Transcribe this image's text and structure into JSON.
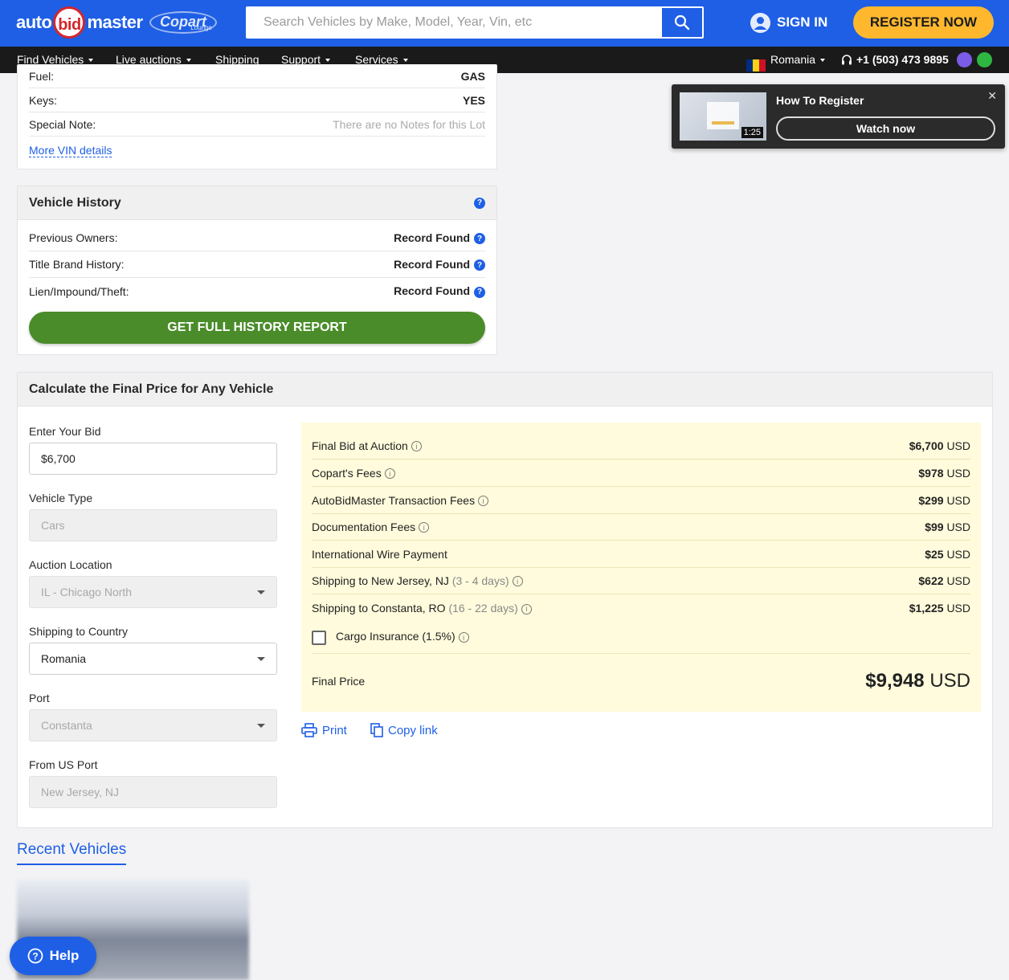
{
  "header": {
    "logo_left": "auto",
    "logo_mid": "bid",
    "logo_right": "master",
    "partner_logo": "Copart",
    "partner_sub": "Lounge",
    "search_placeholder": "Search Vehicles by Make, Model, Year, Vin, etc",
    "sign_in": "SIGN IN",
    "register": "REGISTER NOW"
  },
  "nav": {
    "items": [
      "Find Vehicles",
      "Live auctions",
      "Shipping",
      "Support",
      "Services"
    ],
    "country": "Romania",
    "phone": "+1 (503) 473 9895"
  },
  "lot_details": {
    "rows": [
      {
        "label": "Fuel:",
        "value": "GAS"
      },
      {
        "label": "Keys:",
        "value": "YES"
      },
      {
        "label": "Special Note:",
        "value": "There are no Notes for this Lot"
      }
    ],
    "more_link": "More VIN details"
  },
  "vehicle_history": {
    "title": "Vehicle History",
    "rows": [
      {
        "label": "Previous Owners:",
        "value": "Record Found"
      },
      {
        "label": "Title Brand History:",
        "value": "Record Found"
      },
      {
        "label": "Lien/Impound/Theft:",
        "value": "Record Found"
      }
    ],
    "button": "GET FULL HISTORY REPORT"
  },
  "calculator": {
    "title": "Calculate the Final Price for Any Vehicle",
    "bid_label": "Enter Your Bid",
    "bid_value": "$6,700",
    "vehicle_type_label": "Vehicle Type",
    "vehicle_type_value": "Cars",
    "auction_location_label": "Auction Location",
    "auction_location_value": "IL - Chicago North",
    "shipping_country_label": "Shipping to Country",
    "shipping_country_value": "Romania",
    "port_label": "Port",
    "port_value": "Constanta",
    "from_port_label": "From US Port",
    "from_port_value": "New Jersey, NJ",
    "breakdown": [
      {
        "label": "Final Bid at Auction",
        "extra": "",
        "amount": "$6,700",
        "currency": "USD"
      },
      {
        "label": "Copart's Fees",
        "extra": "",
        "amount": "$978",
        "currency": "USD"
      },
      {
        "label": "AutoBidMaster Transaction Fees",
        "extra": "",
        "amount": "$299",
        "currency": "USD"
      },
      {
        "label": "Documentation Fees",
        "extra": "",
        "amount": "$99",
        "currency": "USD"
      },
      {
        "label": "International Wire Payment",
        "extra": "",
        "amount": "$25",
        "currency": "USD"
      },
      {
        "label": "Shipping to New Jersey, NJ",
        "extra": "(3 - 4 days)",
        "amount": "$622",
        "currency": "USD"
      },
      {
        "label": "Shipping to Constanta, RO",
        "extra": "(16 - 22 days)",
        "amount": "$1,225",
        "currency": "USD"
      }
    ],
    "insurance_label": "Cargo Insurance (1.5%)",
    "final_label": "Final Price",
    "final_amount": "$9,948",
    "final_currency": "USD",
    "print": "Print",
    "copy_link": "Copy link"
  },
  "popup": {
    "title": "How To Register",
    "duration": "1:25",
    "button": "Watch now"
  },
  "recent": {
    "title": "Recent Vehicles"
  },
  "help": {
    "label": "Help"
  }
}
